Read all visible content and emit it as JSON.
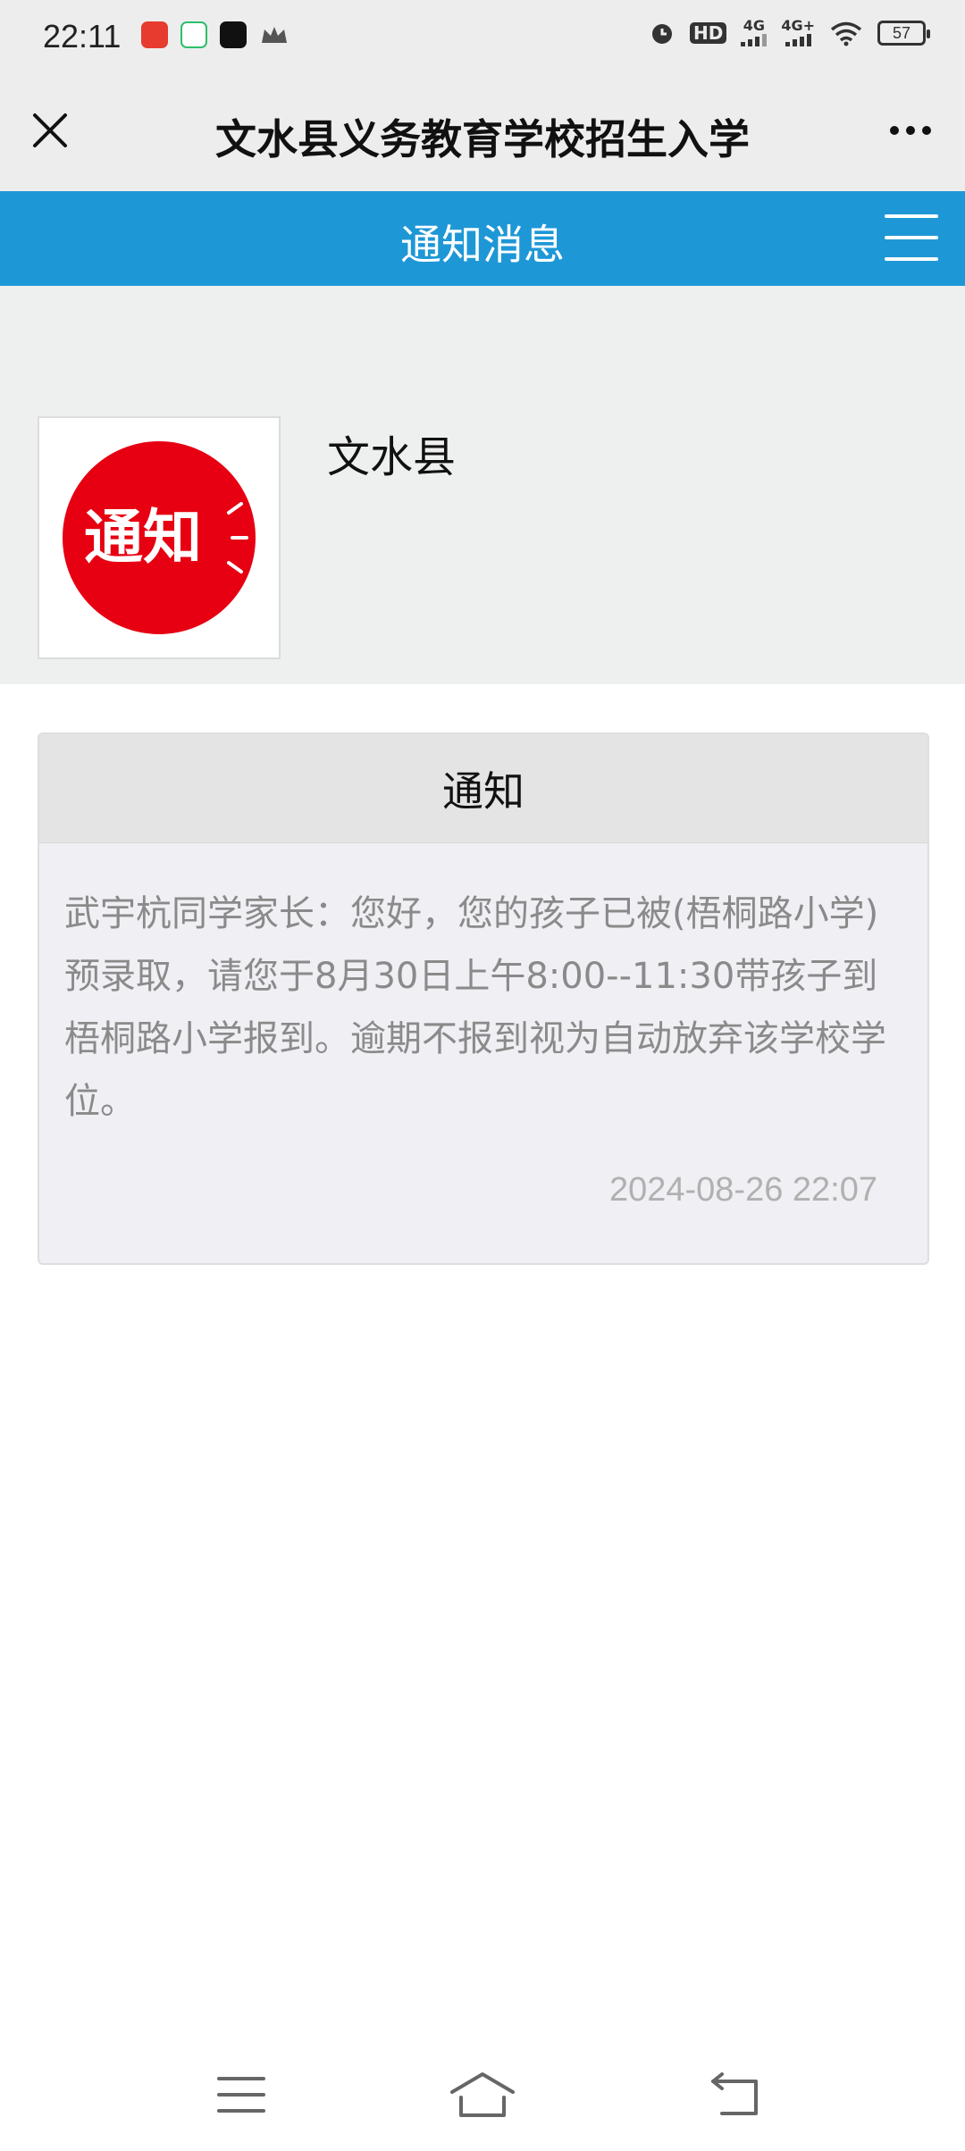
{
  "status_bar": {
    "time": "22:11",
    "battery": "57",
    "network_1": "4G",
    "network_2": "4G+",
    "hd_label": "HD"
  },
  "title_bar": {
    "title": "文水县义务教育学校招生入学"
  },
  "header": {
    "title": "通知消息"
  },
  "profile": {
    "name": "文水县",
    "logo_text": "通知",
    "logo_color": "#e60012"
  },
  "notice": {
    "heading": "通知",
    "body": "武宇杭同学家长：您好，您的孩子已被(梧桐路小学)预录取，请您于8月30日上午8:00--11:30带孩子到梧桐路小学报到。逾期不报到视为自动放弃该学校学位。",
    "timestamp": "2024-08-26 22:07"
  },
  "colors": {
    "accent": "#1e97d6",
    "title_bar_bg": "#ededed",
    "profile_bg": "#eef0f0"
  },
  "icons": {
    "close": "close-icon",
    "more": "more-icon",
    "menu": "menu-icon",
    "nav_menu": "nav-menu-icon",
    "nav_home": "home-icon",
    "nav_back": "back-icon"
  }
}
